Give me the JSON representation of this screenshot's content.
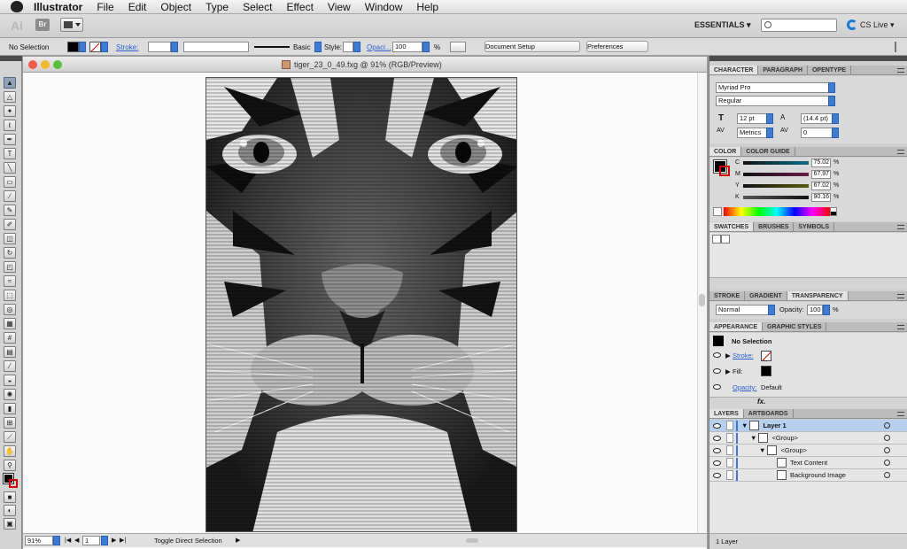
{
  "menubar": {
    "app_name": "Illustrator",
    "items": [
      "File",
      "Edit",
      "Object",
      "Type",
      "Select",
      "Effect",
      "View",
      "Window",
      "Help"
    ]
  },
  "appbar": {
    "logo": "Ai",
    "bridge": "Br",
    "workspace": "ESSENTIALS ▾",
    "cs_live": "CS Live ▾"
  },
  "control": {
    "selection": "No Selection",
    "stroke_label": "Stroke:",
    "brush": "Basic",
    "style_label": "Style:",
    "opacity_label": "Opaci...",
    "opacity_value": "100",
    "percent": "%",
    "doc_setup": "Document Setup",
    "preferences": "Preferences"
  },
  "document": {
    "title": "tiger_23_0_49.fxg @ 91% (RGB/Preview)"
  },
  "status": {
    "zoom": "91%",
    "page": "1",
    "tool_hint": "Toggle Direct Selection"
  },
  "character": {
    "tabs": [
      "CHARACTER",
      "PARAGRAPH",
      "OPENTYPE"
    ],
    "font": "Myriad Pro",
    "style": "Regular",
    "size": "12 pt",
    "leading": "(14.4 pt)",
    "kerning": "Metrics",
    "tracking": "0"
  },
  "color": {
    "tabs": [
      "COLOR",
      "COLOR GUIDE"
    ],
    "channels": [
      {
        "label": "C",
        "value": "75.02"
      },
      {
        "label": "M",
        "value": "67.97"
      },
      {
        "label": "Y",
        "value": "67.02"
      },
      {
        "label": "K",
        "value": "90.16"
      }
    ],
    "percent": "%"
  },
  "swatches": {
    "tabs": [
      "SWATCHES",
      "BRUSHES",
      "SYMBOLS"
    ]
  },
  "transparency": {
    "tabs": [
      "STROKE",
      "GRADIENT",
      "TRANSPARENCY"
    ],
    "mode": "Normal",
    "opacity_label": "Opacity:",
    "opacity_value": "100",
    "percent": "%"
  },
  "appearance": {
    "tabs": [
      "APPEARANCE",
      "GRAPHIC STYLES"
    ],
    "header": "No Selection",
    "stroke": "Stroke:",
    "fill": "Fill:",
    "opacity": "Opacity:",
    "opacity_value": "Default"
  },
  "layers": {
    "tabs": [
      "LAYERS",
      "ARTBOARDS"
    ],
    "rows": [
      {
        "label": "Layer 1"
      },
      {
        "label": "<Group>"
      },
      {
        "label": "<Group>"
      },
      {
        "label": "Text Content"
      },
      {
        "label": "Background Image"
      }
    ],
    "count": "1 Layer"
  }
}
